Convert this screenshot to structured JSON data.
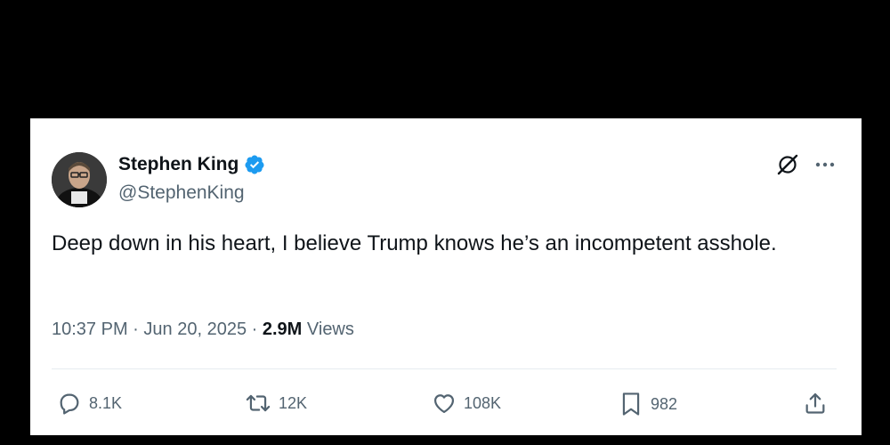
{
  "tweet": {
    "author": {
      "display_name": "Stephen King",
      "handle": "@StephenKing",
      "verified": true
    },
    "text": "Deep down in his heart, I believe Trump knows he’s an incompetent asshole.",
    "time": "10:37 PM",
    "date": "Jun 20, 2025",
    "separator": "·",
    "views_count": "2.9M",
    "views_label": "Views",
    "actions": {
      "replies": "8.1K",
      "retweets": "12K",
      "likes": "108K",
      "bookmarks": "982"
    }
  },
  "colors": {
    "background": "#000000",
    "card": "#ffffff",
    "text_primary": "#0f1419",
    "text_secondary": "#536471",
    "verified_blue": "#1d9bf0"
  },
  "icons": {
    "verified": "verified-badge-icon",
    "grok": "grok-icon",
    "more": "more-icon",
    "reply": "reply-icon",
    "retweet": "retweet-icon",
    "like": "heart-icon",
    "bookmark": "bookmark-icon",
    "share": "share-icon"
  }
}
